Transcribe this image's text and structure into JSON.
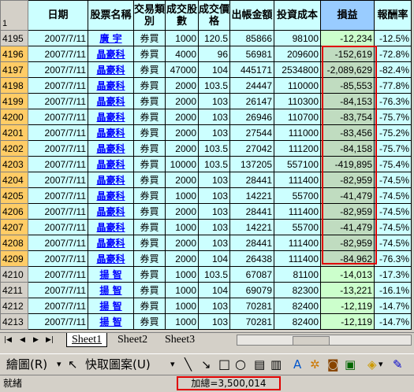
{
  "header": {
    "row_number": "1",
    "columns": [
      "日期",
      "股票名稱",
      "交易類別",
      "成交股數",
      "成交價格",
      "出帳金額",
      "投資成本",
      "損益",
      "報酬率"
    ]
  },
  "rows": [
    {
      "n": "4195",
      "date": "2007/7/11",
      "name": "廣 宇",
      "type": "券買",
      "shares": "1000",
      "price": "120.5",
      "out": "85866",
      "cost": "98100",
      "pl": "-12,234",
      "ret": "-12.5%",
      "sel": false
    },
    {
      "n": "4196",
      "date": "2007/7/11",
      "name": "晶豪科",
      "type": "券買",
      "shares": "4000",
      "price": "96",
      "out": "56981",
      "cost": "209600",
      "pl": "-152,619",
      "ret": "-72.8%",
      "sel": true
    },
    {
      "n": "4197",
      "date": "2007/7/11",
      "name": "晶豪科",
      "type": "券買",
      "shares": "47000",
      "price": "104",
      "out": "445171",
      "cost": "2534800",
      "pl": "-2,089,629",
      "ret": "-82.4%",
      "sel": true
    },
    {
      "n": "4198",
      "date": "2007/7/11",
      "name": "晶豪科",
      "type": "券買",
      "shares": "2000",
      "price": "103.5",
      "out": "24447",
      "cost": "110000",
      "pl": "-85,553",
      "ret": "-77.8%",
      "sel": true
    },
    {
      "n": "4199",
      "date": "2007/7/11",
      "name": "晶豪科",
      "type": "券買",
      "shares": "2000",
      "price": "103",
      "out": "26147",
      "cost": "110300",
      "pl": "-84,153",
      "ret": "-76.3%",
      "sel": true
    },
    {
      "n": "4200",
      "date": "2007/7/11",
      "name": "晶豪科",
      "type": "券買",
      "shares": "2000",
      "price": "103",
      "out": "26946",
      "cost": "110700",
      "pl": "-83,754",
      "ret": "-75.7%",
      "sel": true
    },
    {
      "n": "4201",
      "date": "2007/7/11",
      "name": "晶豪科",
      "type": "券買",
      "shares": "2000",
      "price": "103",
      "out": "27544",
      "cost": "111000",
      "pl": "-83,456",
      "ret": "-75.2%",
      "sel": true
    },
    {
      "n": "4202",
      "date": "2007/7/11",
      "name": "晶豪科",
      "type": "券買",
      "shares": "2000",
      "price": "103.5",
      "out": "27042",
      "cost": "111200",
      "pl": "-84,158",
      "ret": "-75.7%",
      "sel": true
    },
    {
      "n": "4203",
      "date": "2007/7/11",
      "name": "晶豪科",
      "type": "券買",
      "shares": "10000",
      "price": "103.5",
      "out": "137205",
      "cost": "557100",
      "pl": "-419,895",
      "ret": "-75.4%",
      "sel": true
    },
    {
      "n": "4204",
      "date": "2007/7/11",
      "name": "晶豪科",
      "type": "券買",
      "shares": "2000",
      "price": "103",
      "out": "28441",
      "cost": "111400",
      "pl": "-82,959",
      "ret": "-74.5%",
      "sel": true
    },
    {
      "n": "4205",
      "date": "2007/7/11",
      "name": "晶豪科",
      "type": "券買",
      "shares": "1000",
      "price": "103",
      "out": "14221",
      "cost": "55700",
      "pl": "-41,479",
      "ret": "-74.5%",
      "sel": true
    },
    {
      "n": "4206",
      "date": "2007/7/11",
      "name": "晶豪科",
      "type": "券買",
      "shares": "2000",
      "price": "103",
      "out": "28441",
      "cost": "111400",
      "pl": "-82,959",
      "ret": "-74.5%",
      "sel": true
    },
    {
      "n": "4207",
      "date": "2007/7/11",
      "name": "晶豪科",
      "type": "券買",
      "shares": "1000",
      "price": "103",
      "out": "14221",
      "cost": "55700",
      "pl": "-41,479",
      "ret": "-74.5%",
      "sel": true
    },
    {
      "n": "4208",
      "date": "2007/7/11",
      "name": "晶豪科",
      "type": "券買",
      "shares": "2000",
      "price": "103",
      "out": "28441",
      "cost": "111400",
      "pl": "-82,959",
      "ret": "-74.5%",
      "sel": true
    },
    {
      "n": "4209",
      "date": "2007/7/11",
      "name": "晶豪科",
      "type": "券買",
      "shares": "2000",
      "price": "104",
      "out": "26438",
      "cost": "111400",
      "pl": "-84,962",
      "ret": "-76.3%",
      "sel": true
    },
    {
      "n": "4210",
      "date": "2007/7/11",
      "name": "揚 智",
      "type": "券買",
      "shares": "1000",
      "price": "103.5",
      "out": "67087",
      "cost": "81100",
      "pl": "-14,013",
      "ret": "-17.3%",
      "sel": false
    },
    {
      "n": "4211",
      "date": "2007/7/11",
      "name": "揚 智",
      "type": "券買",
      "shares": "1000",
      "price": "104",
      "out": "69079",
      "cost": "82300",
      "pl": "-13,221",
      "ret": "-16.1%",
      "sel": false
    },
    {
      "n": "4212",
      "date": "2007/7/11",
      "name": "揚 智",
      "type": "券買",
      "shares": "1000",
      "price": "103",
      "out": "70281",
      "cost": "82400",
      "pl": "-12,119",
      "ret": "-14.7%",
      "sel": false
    },
    {
      "n": "4213",
      "date": "2007/7/11",
      "name": "揚 智",
      "type": "券買",
      "shares": "1000",
      "price": "103",
      "out": "70281",
      "cost": "82400",
      "pl": "-12,119",
      "ret": "-14.7%",
      "sel": false
    }
  ],
  "sheet_tabs": [
    "Sheet1",
    "Sheet2",
    "Sheet3"
  ],
  "active_sheet": "Sheet1",
  "drawing_toolbar": {
    "draw_menu": "繪圖(R)",
    "autoshapes_menu": "快取圖案(U)"
  },
  "status": {
    "ready": "就緒",
    "sum": "加總=3,500,014"
  },
  "colors": {
    "cell_bg": "#ccffff",
    "pl_bg": "#ccffcc",
    "selected_row_header": "#ffcc66",
    "highlight_border": "#e00000",
    "stock_link": "#0000ff"
  }
}
